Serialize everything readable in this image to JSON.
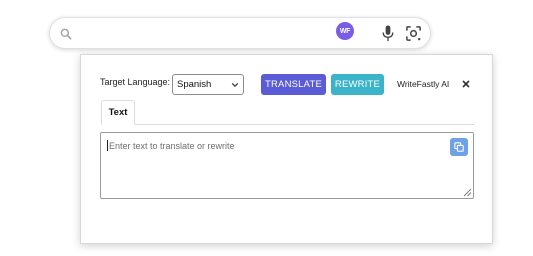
{
  "extension": {
    "badge": "WF",
    "target_language_label": "Target Language:",
    "selected_language": "Spanish",
    "translate_button": "TRANSLATE",
    "rewrite_button": "REWRITE",
    "brand_name": "WriteFastly AI",
    "tabs": [
      {
        "label": "Text"
      }
    ],
    "textarea": {
      "placeholder": "Enter text to translate or rewrite",
      "value": ""
    }
  },
  "icons": {
    "search": "search-icon",
    "mic": "mic-icon",
    "lens": "lens-icon",
    "close": "close-icon",
    "copy": "copy-icon",
    "dropdown": "chevron-down-icon"
  },
  "colors": {
    "translate": "#5b5bd6",
    "rewrite": "#3bb3c9",
    "badge": "#7b5ce6",
    "copy": "#6ea2e8"
  }
}
